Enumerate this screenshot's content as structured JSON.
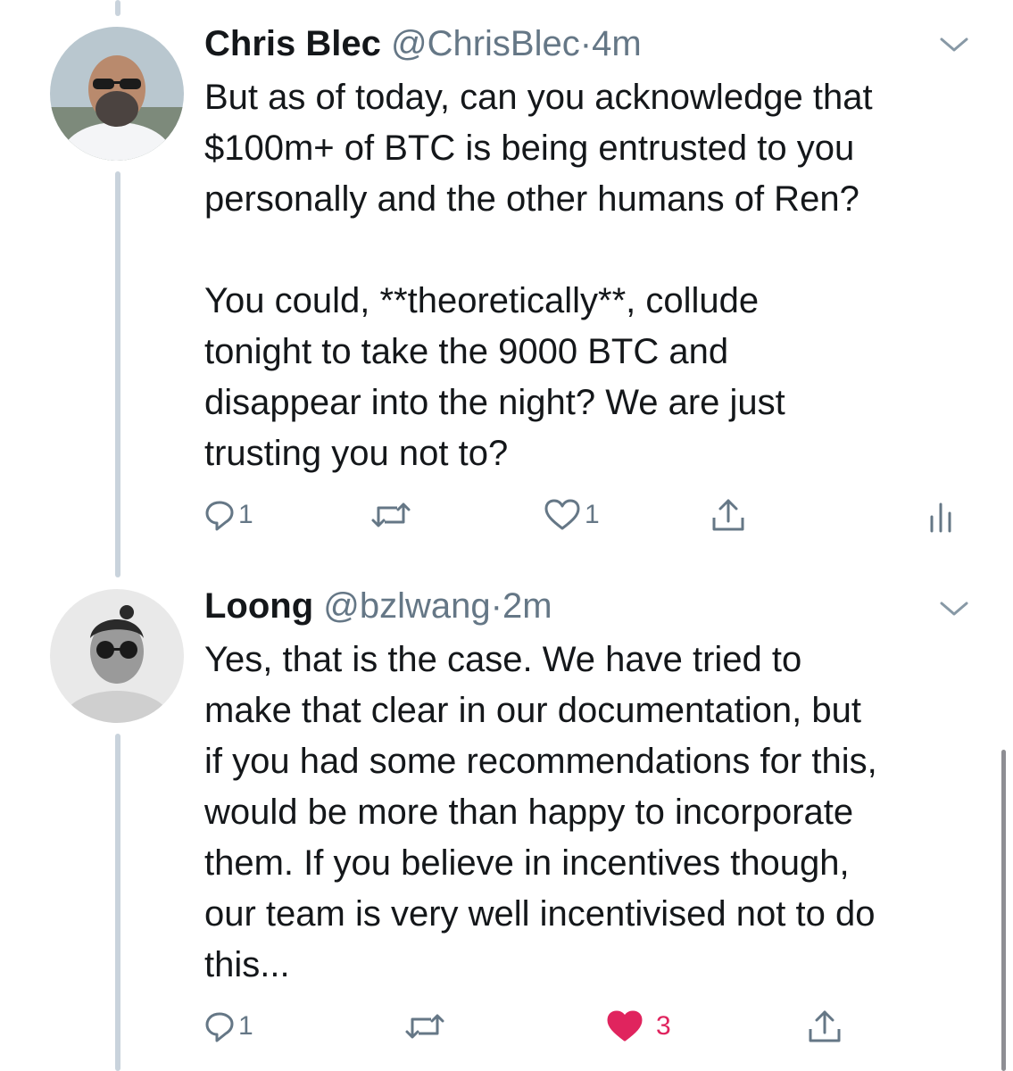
{
  "tweets": [
    {
      "name": "Chris Blec",
      "handle": "@ChrisBlec",
      "separator": "·",
      "time": "4m",
      "text": "But as of today, can you acknowledge that\n$100m+ of BTC is being entrusted to you\npersonally and the other humans of Ren?\n\nYou could, **theoretically**, collude\ntonight to take the 9000 BTC and\ndisappear into the night? We are just\ntrusting you not to?",
      "reply_count": "1",
      "like_count": "1",
      "liked": false
    },
    {
      "name": "Loong",
      "handle": "@bzlwang",
      "separator": "·",
      "time": "2m",
      "text": "Yes, that is the case. We have tried to\nmake that clear in our documentation, but\nif you had some recommendations for this,\nwould be more than happy to incorporate\nthem. If you believe in incentives though,\nour team is very well incentivised not to do\nthis...",
      "reply_count": "1",
      "like_count": "3",
      "liked": true
    }
  ],
  "colors": {
    "text": "#14171a",
    "secondary": "#657786",
    "thread_line": "#c9d3dc",
    "like_active": "#e0245e"
  },
  "icons": [
    "reply-icon",
    "retweet-icon",
    "like-icon",
    "share-icon",
    "analytics-icon",
    "chevron-down-icon"
  ]
}
